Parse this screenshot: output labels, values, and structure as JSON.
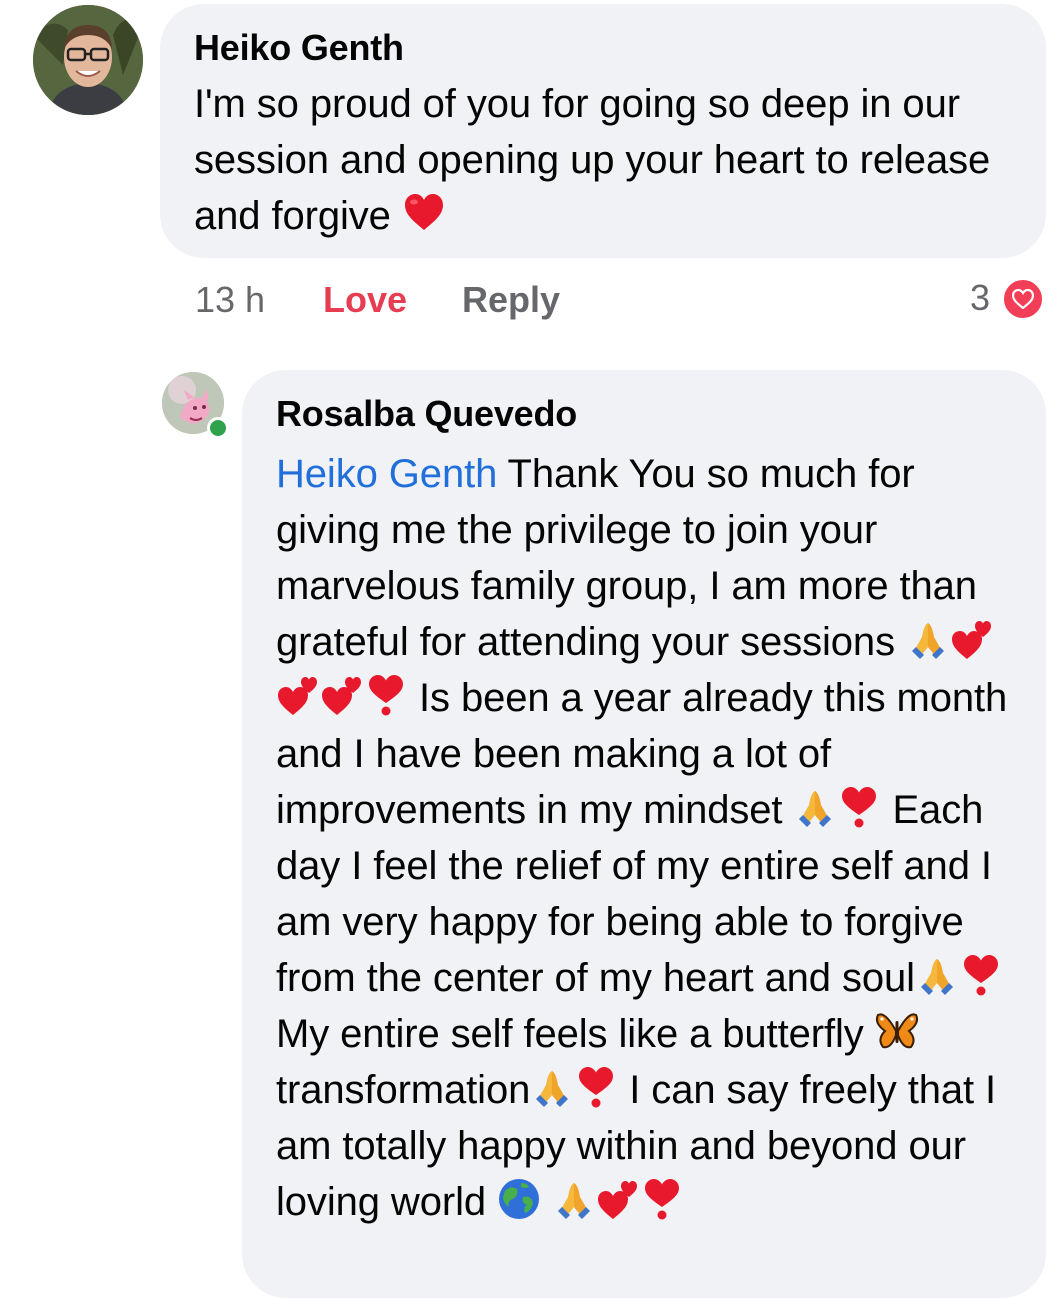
{
  "comment": {
    "author": "Heiko Genth",
    "text": "I'm so proud of you for going so deep in our session and opening up your heart to release and forgive",
    "time": "13 h",
    "love_label": "Love",
    "reply_label": "Reply",
    "reaction_count": "3",
    "reaction_icon": "heart-reaction-icon",
    "colors": {
      "love": "#e63d53",
      "reaction": "#f33e58",
      "bubble": "#f0f2f5"
    }
  },
  "reply": {
    "author": "Rosalba Quevedo",
    "mention": "Heiko Genth",
    "online": true,
    "segments": [
      " Thank You so much for giving me the privilege to join your marvelous family group, I am more than grateful for attending your sessions ",
      " Is been a year already this month and I have been making a lot of improvements in my mindset ",
      " Each day I feel the relief of my entire self and I am very happy for being able to forgive from the center of my heart and soul",
      " My entire self feels like a butterfly ",
      " transformation",
      " I can say freely that I am totally happy within and beyond our loving world "
    ],
    "colors": {
      "mention": "#216fdb",
      "online": "#31a24c"
    }
  }
}
